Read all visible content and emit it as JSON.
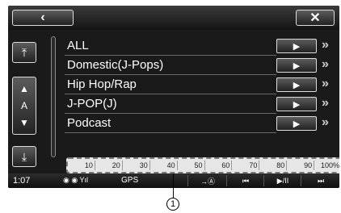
{
  "topbar": {
    "back_icon": "‹",
    "close_icon": "✕"
  },
  "left": {
    "top_icon": "⤒",
    "up_icon": "▲",
    "az_label": "A",
    "down_icon": "▼",
    "bottom_icon": "⤓"
  },
  "list": {
    "items": [
      {
        "label": "ALL",
        "play_icon": "▶",
        "more_icon": "»"
      },
      {
        "label": "Domestic(J-Pops)",
        "play_icon": "▶",
        "more_icon": "»"
      },
      {
        "label": "Hip Hop/Rap",
        "play_icon": "▶",
        "more_icon": "»"
      },
      {
        "label": "J-POP(J)",
        "play_icon": "▶",
        "more_icon": "»"
      },
      {
        "label": "Podcast",
        "play_icon": "▶",
        "more_icon": "»"
      }
    ]
  },
  "scale": {
    "ticks": [
      "10",
      "20",
      "30",
      "40",
      "50",
      "60",
      "70",
      "80",
      "90",
      "100%"
    ]
  },
  "status": {
    "time": "1:07",
    "icons_text": "◉ ◉ Yıl",
    "gps": "GPS",
    "nav_icon": "→Ⓐ",
    "prev_icon": "⏮",
    "playpause_icon": "▶/II",
    "next_icon": "⏭"
  },
  "callout": {
    "label": "1"
  }
}
